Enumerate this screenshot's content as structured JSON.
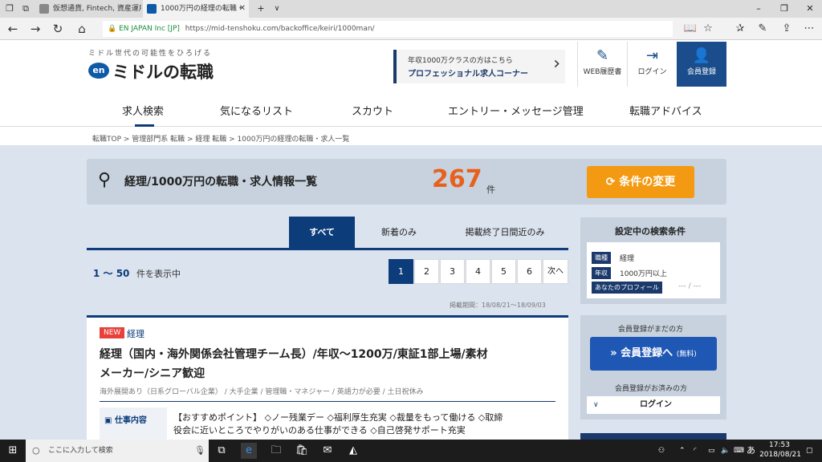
{
  "browser": {
    "tabs": [
      {
        "title": "仮想通貨, Fintech, 資産運用"
      },
      {
        "title": "1000万円の経理の転職・"
      }
    ],
    "new_tab": "+",
    "tab_dropdown": "∨",
    "cert_org": "EN JAPAN Inc [JP]",
    "url": "https://mid-tenshoku.com/backoffice/keiri/1000man/"
  },
  "site": {
    "tagline": "ミドル世代の可能性をひろげる",
    "logo_mark": "en",
    "logo_text": "ミドルの転職",
    "pro_banner": {
      "line1": "年収1000万クラスの方はこちら",
      "line2": "プロフェッショナル求人コーナー",
      "arrow": "›"
    },
    "header_buttons": [
      {
        "label": "WEB履歴書"
      },
      {
        "label": "ログイン"
      },
      {
        "label": "会員登録"
      }
    ],
    "nav": [
      "求人検索",
      "気になるリスト",
      "スカウト",
      "エントリー・メッセージ管理",
      "転職アドバイス"
    ],
    "breadcrumbs": "転職TOP > 管理部門系 転職 > 経理 転職 > 1000万円の経理の転職・求人一覧"
  },
  "search": {
    "heading": "経理/1000万円の転職・求人情報一覧",
    "count": "267",
    "count_unit": "件",
    "change_button": "条件の変更"
  },
  "content_tabs": [
    "すべて",
    "新着のみ",
    "掲載終了日間近のみ"
  ],
  "results": {
    "range": "1 ～ 50",
    "range_suffix": "件を表示中",
    "pages": [
      "1",
      "2",
      "3",
      "4",
      "5",
      "6",
      "次へ"
    ],
    "posted_period": "掲載期間：18/08/21～18/09/03"
  },
  "job": {
    "badge": "NEW",
    "category": "経理",
    "title_line1": "経理（国内・海外関係会社管理チーム長）/年収～1200万/東証1部上場/素材",
    "title_line2": "メーカー/シニア歓迎",
    "tags": "海外展開あり（日系グローバル企業） / 大手企業 / 管理職・マネジャー / 英語力が必要 / 土日祝休み",
    "section_label": "仕事内容",
    "desc_line1": "【おすすめポイント】 ◇ノー残業デー ◇福利厚生充実 ◇裁量をもって働ける ◇取締",
    "desc_line2": "役会に近いところでやりがいのある仕事ができる ◇自己啓発サポート充実"
  },
  "sidebar": {
    "conditions_title": "設定中の検索条件",
    "conditions": [
      {
        "label": "職種",
        "value": "経理"
      },
      {
        "label": "年収",
        "value": "1000万円以上"
      },
      {
        "label": "あなたのプロフィール",
        "value": "--- / ---"
      }
    ],
    "not_member": "会員登録がまだの方",
    "register_button": "会員登録へ",
    "register_free": "(無料)",
    "member": "会員登録がお済みの方",
    "login": "ログイン"
  },
  "taskbar": {
    "search_placeholder": "ここに入力して検索",
    "ime": "あ",
    "time": "17:53",
    "date": "2018/08/21"
  },
  "colors": {
    "accent": "#0d3c7a",
    "orange": "#f39a12",
    "count": "#e8611c",
    "register": "#1f57b4"
  }
}
